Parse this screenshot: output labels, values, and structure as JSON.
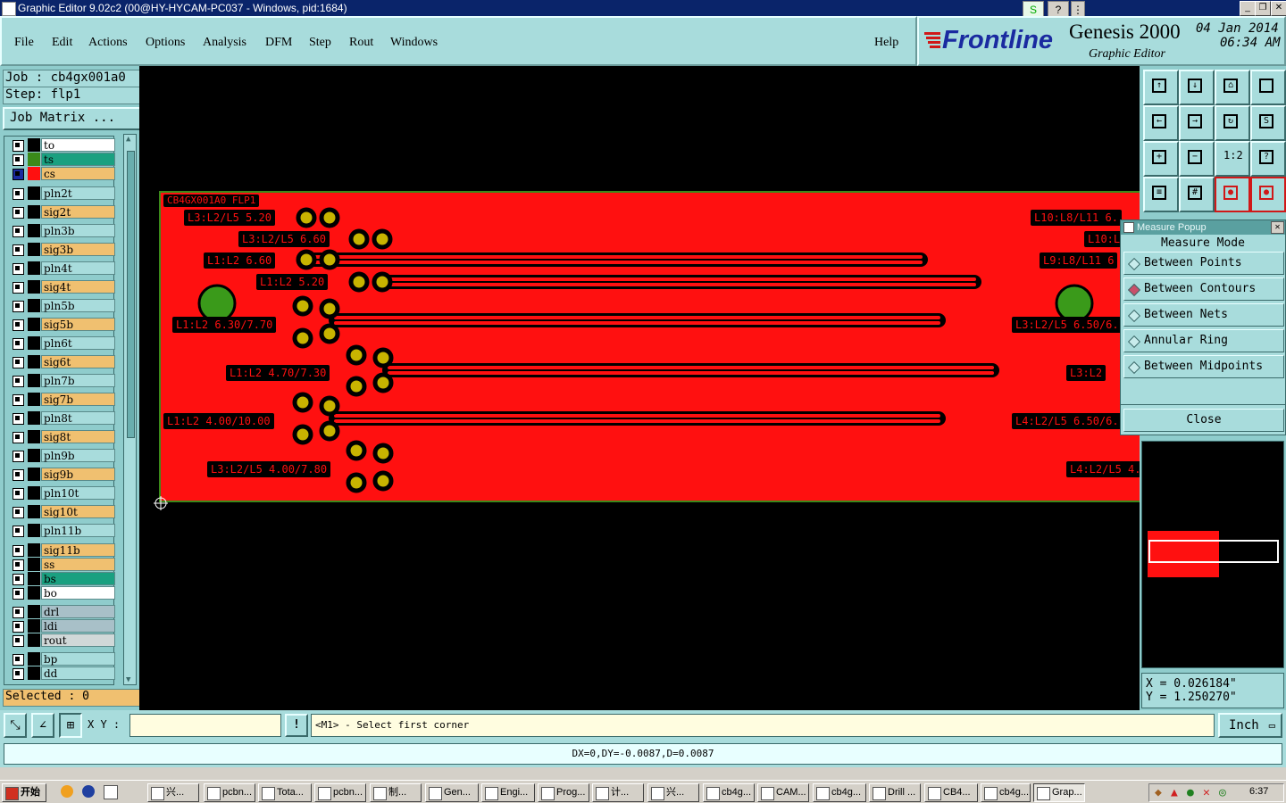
{
  "window": {
    "title": "Graphic Editor 9.02c2 (00@HY-HYCAM-PC037 - Windows, pid:1684)"
  },
  "menu": {
    "items": [
      "File",
      "Edit",
      "Actions",
      "Options",
      "Analysis",
      "DFM",
      "Step",
      "Rout",
      "Windows"
    ],
    "help": "Help"
  },
  "brand": {
    "logo": "Frontline",
    "product": "Genesis 2000",
    "subtitle": "Graphic Editor",
    "date": "04 Jan 2014",
    "time": "06:34 AM"
  },
  "job": {
    "job": "Job : cb4gx001a0",
    "step": "Step: flp1",
    "matrix_button": "Job Matrix ..."
  },
  "layers": [
    {
      "name": "to",
      "color": "#ffffff",
      "swatch": "#000000"
    },
    {
      "name": "ts",
      "color": "#1aa080",
      "swatch": "#3a8a1a"
    },
    {
      "name": "cs",
      "color": "#f0c070",
      "swatch": "#ff1010"
    },
    {
      "name": "pln2t",
      "color": "#a8dcdc",
      "swatch": "#000000"
    },
    {
      "name": "sig2t",
      "color": "#f0c070",
      "swatch": "#000000"
    },
    {
      "name": "pln3b",
      "color": "#a8dcdc",
      "swatch": "#000000"
    },
    {
      "name": "sig3b",
      "color": "#f0c070",
      "swatch": "#000000"
    },
    {
      "name": "pln4t",
      "color": "#a8dcdc",
      "swatch": "#000000"
    },
    {
      "name": "sig4t",
      "color": "#f0c070",
      "swatch": "#000000"
    },
    {
      "name": "pln5b",
      "color": "#a8dcdc",
      "swatch": "#000000"
    },
    {
      "name": "sig5b",
      "color": "#f0c070",
      "swatch": "#000000"
    },
    {
      "name": "pln6t",
      "color": "#a8dcdc",
      "swatch": "#000000"
    },
    {
      "name": "sig6t",
      "color": "#f0c070",
      "swatch": "#000000"
    },
    {
      "name": "pln7b",
      "color": "#a8dcdc",
      "swatch": "#000000"
    },
    {
      "name": "sig7b",
      "color": "#f0c070",
      "swatch": "#000000"
    },
    {
      "name": "pln8t",
      "color": "#a8dcdc",
      "swatch": "#000000"
    },
    {
      "name": "sig8t",
      "color": "#f0c070",
      "swatch": "#000000"
    },
    {
      "name": "pln9b",
      "color": "#a8dcdc",
      "swatch": "#000000"
    },
    {
      "name": "sig9b",
      "color": "#f0c070",
      "swatch": "#000000"
    },
    {
      "name": "pln10t",
      "color": "#a8dcdc",
      "swatch": "#000000"
    },
    {
      "name": "sig10t",
      "color": "#f0c070",
      "swatch": "#000000"
    },
    {
      "name": "pln11b",
      "color": "#a8dcdc",
      "swatch": "#000000"
    },
    {
      "name": "sig11b",
      "color": "#f0c070",
      "swatch": "#000000"
    },
    {
      "name": "ss",
      "color": "#f0c070",
      "swatch": "#000000"
    },
    {
      "name": "bs",
      "color": "#1aa080",
      "swatch": "#000000"
    },
    {
      "name": "bo",
      "color": "#ffffff",
      "swatch": "#000000"
    },
    {
      "name": "drl",
      "color": "#a8c0c8",
      "swatch": "#000000"
    },
    {
      "name": "ldi",
      "color": "#a8c0c8",
      "swatch": "#000000"
    },
    {
      "name": "rout",
      "color": "#d0d8d8",
      "swatch": "#000000"
    },
    {
      "name": "bp",
      "color": "#a8dcdc",
      "swatch": "#000000"
    },
    {
      "name": "dd",
      "color": "#a8dcdc",
      "swatch": "#000000"
    }
  ],
  "selected": "Selected : 0",
  "board_labels": {
    "title": "CB4GX001A0 FLP1",
    "left": [
      "L3:L2/L5 5.20",
      "L3:L2/L5 6.60",
      "L1:L2 6.60",
      "L1:L2 5.20",
      "L1:L2 6.30/7.70",
      "L1:L2 4.70/7.30",
      "L1:L2 4.00/10.00",
      "L3:L2/L5 4.00/7.80"
    ],
    "right": [
      "L10:L8/L11 6.",
      "L10:L",
      "L9:L8/L11 6",
      "L3:L2/L5 6.50/6.",
      "L3:L2",
      "L4:L2/L5 6.50/6.",
      "L4:L2/L5 4."
    ]
  },
  "measure_popup": {
    "title": "Measure Popup",
    "heading": "Measure Mode",
    "modes": [
      {
        "label": "Between Points",
        "selected": false
      },
      {
        "label": "Between Contours",
        "selected": true
      },
      {
        "label": "Between Nets",
        "selected": false
      },
      {
        "label": "Annular Ring",
        "selected": false
      },
      {
        "label": "Between Midpoints",
        "selected": false
      }
    ],
    "close": "Close"
  },
  "coords": {
    "x": "X = 0.026184\"",
    "y": "Y = 1.250270\""
  },
  "command": {
    "xy_label": "X Y :",
    "xy_value": "",
    "prompt": "<M1> - Select first corner",
    "units": "Inch"
  },
  "status": "DX=0,DY=-0.0087,D=0.0087",
  "taskbar": {
    "start": "开始",
    "items": [
      "兴...",
      "pcbn...",
      "Tota...",
      "pcbn...",
      "制...",
      "Gen...",
      "Engi...",
      "Prog...",
      "计...",
      "兴...",
      "cb4g...",
      "CAM...",
      "cb4g...",
      "Drill ...",
      "CB4...",
      "cb4g...",
      "Grap..."
    ],
    "clock": "6:37"
  }
}
